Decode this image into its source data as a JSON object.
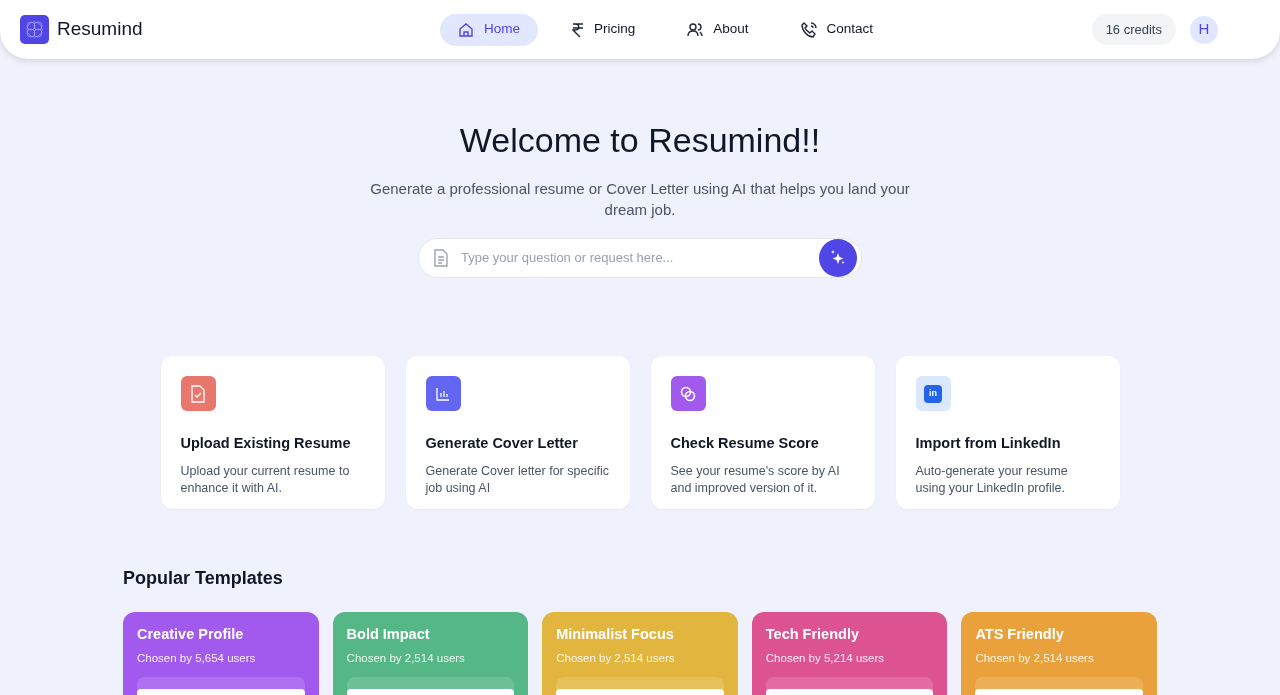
{
  "brand": {
    "name": "Resumind"
  },
  "nav": [
    {
      "label": "Home",
      "kind": "home",
      "selected": true
    },
    {
      "label": "Pricing",
      "kind": "rupee",
      "selected": false
    },
    {
      "label": "About",
      "kind": "users",
      "selected": false
    },
    {
      "label": "Contact",
      "kind": "phone",
      "selected": false
    }
  ],
  "credits": "16 credits",
  "avatar": "H",
  "hero": {
    "title": "Welcome to Resumind!!",
    "subtitle": "Generate a professional resume or Cover Letter using AI that helps you land your dream job.",
    "placeholder": "Type your question or request here..."
  },
  "features": [
    {
      "kind": "file-check",
      "color": "#e8776e",
      "title": "Upload Existing Resume",
      "text": "Upload your current resume to enhance it with AI."
    },
    {
      "kind": "chart",
      "color": "#6366f1",
      "title": "Generate Cover Letter",
      "text": "Generate Cover letter for specific job using AI"
    },
    {
      "kind": "rings",
      "color": "#a259ee",
      "title": "Check Resume Score",
      "text": "See your resume's score by AI and improved version of it."
    },
    {
      "kind": "linkedin",
      "logo_text": "in",
      "color": "#dbe8fc",
      "title": "Import from LinkedIn",
      "text": "Auto-generate your resume using your LinkedIn profile."
    }
  ],
  "templates_title": "Popular Templates",
  "templates": [
    {
      "name": "Creative Profile",
      "chosen": "Chosen by 5,654 users",
      "color": "#a259ee"
    },
    {
      "name": "Bold Impact",
      "chosen": "Chosen by 2,514 users",
      "color": "#55b785"
    },
    {
      "name": "Minimalist Focus",
      "chosen": "Chosen by 2,514 users",
      "color": "#e2b53e"
    },
    {
      "name": "Tech Friendly",
      "chosen": "Chosen by 5,214 users",
      "color": "#dd5392"
    },
    {
      "name": "ATS Friendly",
      "chosen": "Chosen by 2,514 users",
      "color": "#e9a23b"
    }
  ]
}
